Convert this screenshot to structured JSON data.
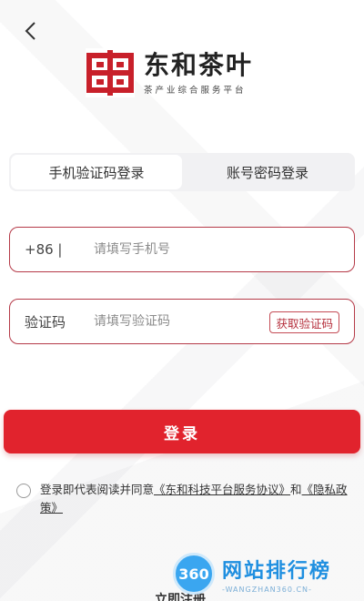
{
  "brand": {
    "name": "东和茶叶",
    "slogan": "茶产业综合服务平台"
  },
  "tabs": [
    {
      "label": "手机验证码登录",
      "active": true
    },
    {
      "label": "账号密码登录",
      "active": false
    }
  ],
  "phone_field": {
    "prefix": "+86 |",
    "placeholder": "请填写手机号"
  },
  "code_field": {
    "label": "验证码",
    "placeholder": "请填写验证码",
    "get_code_label": "获取验证码"
  },
  "login_button": "登录",
  "agreement": {
    "prefix": "登录即代表阅读并同意",
    "link1": "《东和科技平台服务协议》",
    "joiner": "和",
    "link2": "《隐私政策》"
  },
  "register_label": "立即注册",
  "watermark": {
    "badge": "360",
    "title": "网站排行榜",
    "subtitle": "-WANGZHAN360.CN-"
  },
  "colors": {
    "accent": "#e1232d",
    "field_border": "#b53a48",
    "logo_red": "#c8202a"
  }
}
